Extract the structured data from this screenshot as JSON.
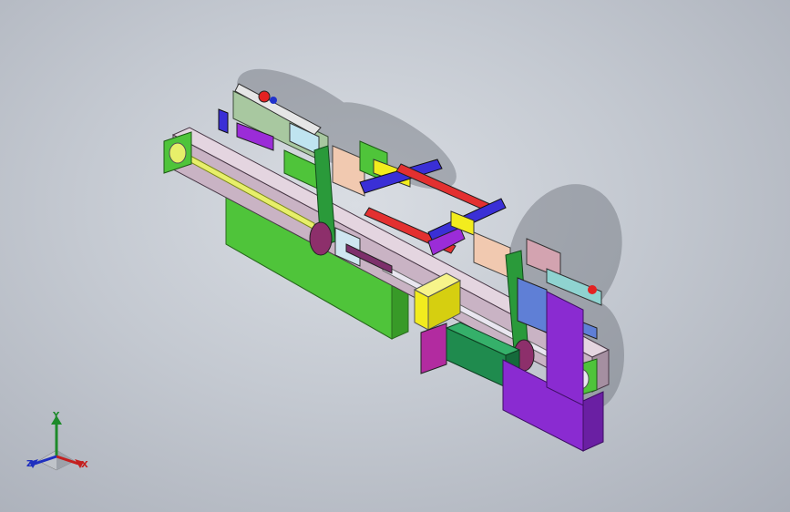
{
  "viewport": {
    "background_top": "#d9dde3",
    "background_bottom": "#a9aeb8"
  },
  "triad": {
    "x_label": "X",
    "y_label": "Y",
    "z_label": "Z",
    "x_color": "#c41f1f",
    "y_color": "#1d8a2a",
    "z_color": "#1f2fbf"
  },
  "model": {
    "base_frame_color": "#c9b3c4",
    "green_panel_color": "#4fc43a",
    "purple_stand_color": "#8a2bd1",
    "yellow_block_color": "#f2ec1e",
    "motor_color": "#1f8b4e",
    "belt_color": "#2a9a3a",
    "shaft_color": "#e7ef6a"
  }
}
